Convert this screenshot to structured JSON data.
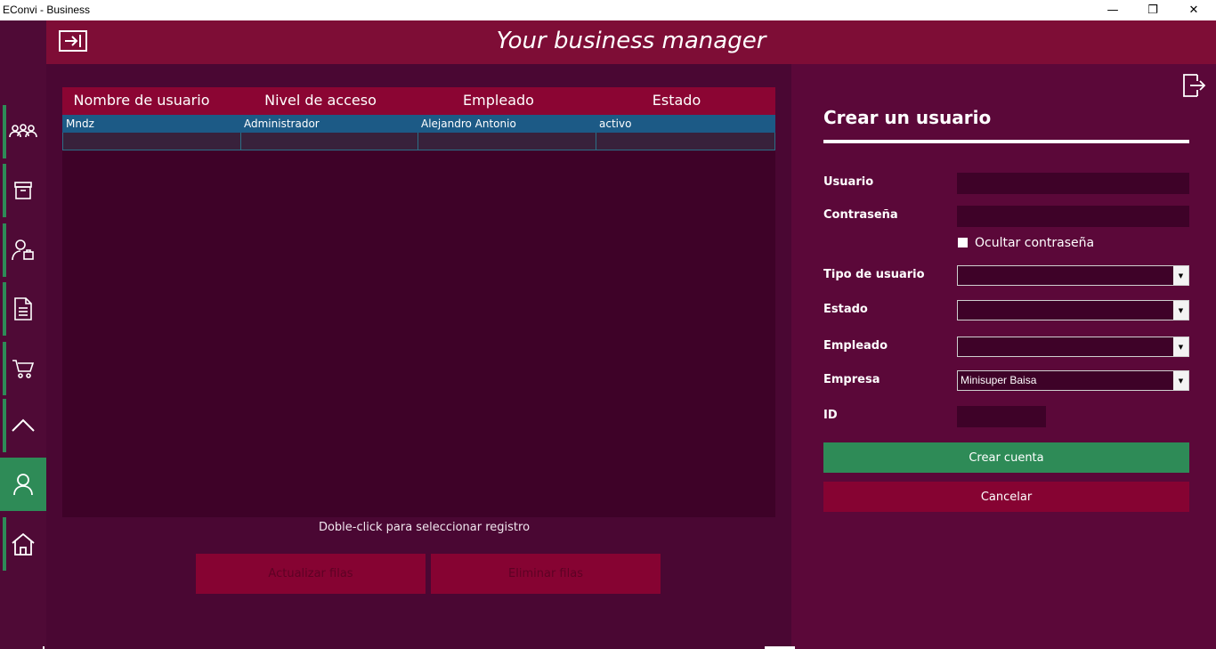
{
  "window": {
    "title": "EConvi - Business",
    "minimize_glyph": "—",
    "maximize_glyph": "❐",
    "close_glyph": "✕"
  },
  "header": {
    "title": "Your business manager",
    "toggle_icon": "sidebar-toggle-icon"
  },
  "nav": {
    "items": [
      {
        "icon": "users-group-icon"
      },
      {
        "icon": "box-icon"
      },
      {
        "icon": "customer-icon"
      },
      {
        "icon": "document-icon"
      },
      {
        "icon": "cart-icon"
      },
      {
        "icon": "chevron-up-icon"
      },
      {
        "icon": "user-icon",
        "active": true
      },
      {
        "icon": "home-icon"
      }
    ]
  },
  "grid": {
    "columns": [
      "Nombre de usuario",
      "Nivel de acceso",
      "Empleado",
      "Estado"
    ],
    "rows": [
      [
        "Mndz",
        "Administrador",
        "Alejandro Antonio",
        "activo"
      ],
      [
        "",
        "",
        "",
        ""
      ]
    ]
  },
  "hint": "Doble-click para seleccionar registro",
  "actions": {
    "update_label": "Actualizar filas",
    "delete_label": "Eliminar filas"
  },
  "form": {
    "title": "Crear un usuario",
    "usuario_label": "Usuario",
    "usuario_value": "",
    "contrasena_label": "Contraseña",
    "contrasena_value": "",
    "ocultar_label": "Ocultar contraseña",
    "ocultar_checked": false,
    "tipo_label": "Tipo de usuario",
    "tipo_value": "",
    "estado_label": "Estado",
    "estado_value": "",
    "empleado_label": "Empleado",
    "empleado_value": "",
    "empresa_label": "Empresa",
    "empresa_value": "Minisuper Baisa",
    "id_label": "ID",
    "id_value": "",
    "submit_label": "Crear cuenta",
    "cancel_label": "Cancelar"
  },
  "colors": {
    "accent_green": "#2e8b57",
    "brand_crimson": "#860332",
    "header": "#7e0d36",
    "grid_selected": "#1c5a86"
  }
}
